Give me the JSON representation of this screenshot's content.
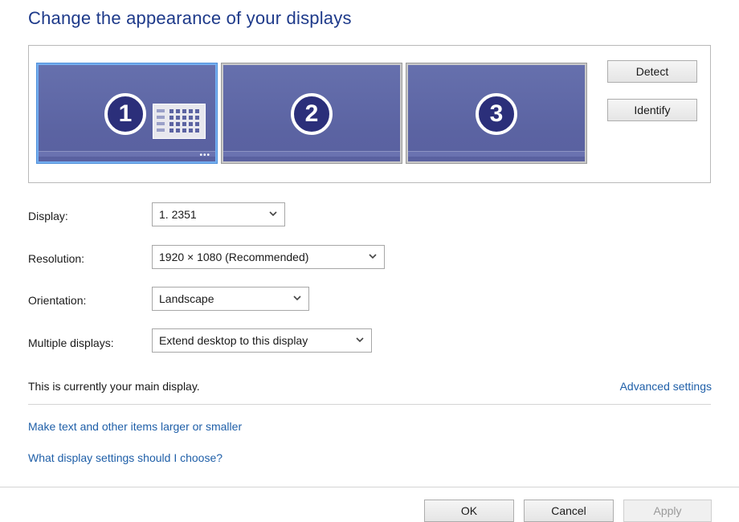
{
  "page": {
    "title": "Change the appearance of your displays"
  },
  "monitors": [
    {
      "number": "1",
      "selected": true
    },
    {
      "number": "2",
      "selected": false
    },
    {
      "number": "3",
      "selected": false
    }
  ],
  "monitor_dots": "•••",
  "buttons": {
    "detect": "Detect",
    "identify": "Identify",
    "ok": "OK",
    "cancel": "Cancel",
    "apply": "Apply"
  },
  "fields": {
    "display": {
      "label": "Display:",
      "value": "1. 2351"
    },
    "resolution": {
      "label": "Resolution:",
      "value": "1920 × 1080 (Recommended)"
    },
    "orientation": {
      "label": "Orientation:",
      "value": "Landscape"
    },
    "multiple": {
      "label": "Multiple displays:",
      "value": "Extend desktop to this display"
    }
  },
  "status_text": "This is currently your main display.",
  "links": {
    "advanced": "Advanced settings",
    "text_size": "Make text and other items larger or smaller",
    "help": "What display settings should I choose?"
  },
  "colors": {
    "title": "#1e3a8a",
    "link": "#1f5fa8",
    "monitor": "#5b63a2",
    "number_badge": "#2b2f7a"
  }
}
